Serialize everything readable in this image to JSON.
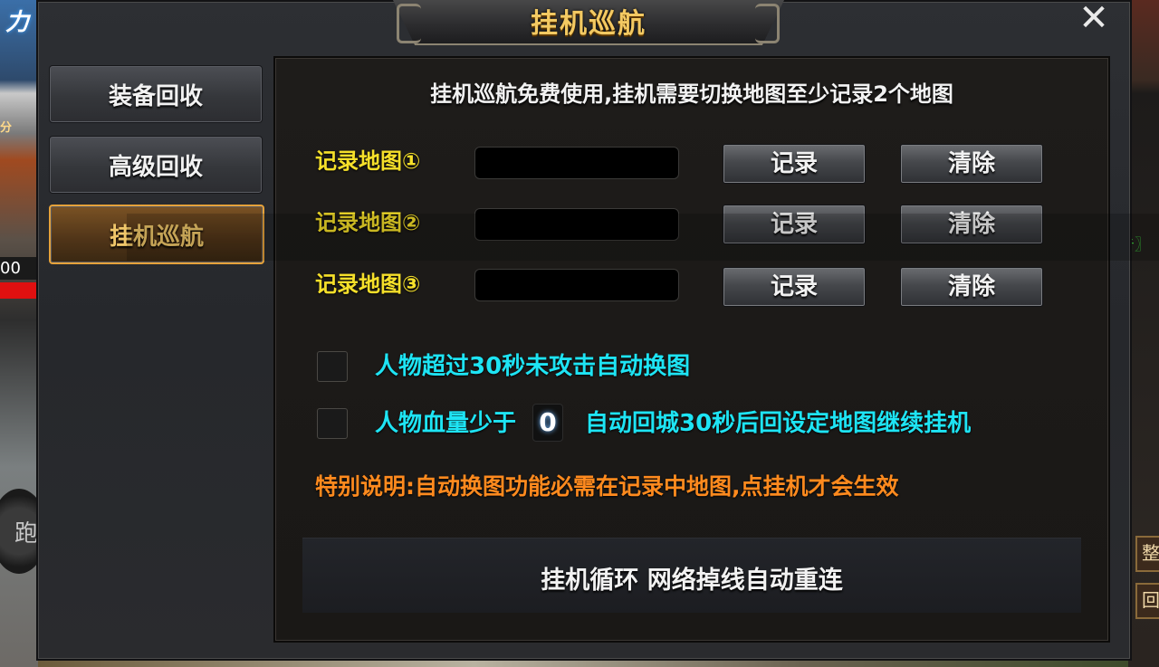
{
  "background": {
    "power_text": "力",
    "score_text": "分",
    "hp_text": "00",
    "run_button": "跑",
    "notice_tag": "〖公告〗",
    "right_buttons": [
      "整",
      "回"
    ]
  },
  "panel": {
    "title": "挂机巡航",
    "close_icon": "close-icon"
  },
  "sidebar": {
    "items": [
      {
        "label": "装备回收",
        "active": false
      },
      {
        "label": "高级回收",
        "active": false
      },
      {
        "label": "挂机巡航",
        "active": true
      }
    ]
  },
  "content": {
    "notice": "挂机巡航免费使用,挂机需要切换地图至少记录2个地图",
    "rows": [
      {
        "label": "记录地图①",
        "value": "",
        "record_label": "记录",
        "clear_label": "清除"
      },
      {
        "label": "记录地图②",
        "value": "",
        "record_label": "记录",
        "clear_label": "清除"
      },
      {
        "label": "记录地图③",
        "value": "",
        "record_label": "记录",
        "clear_label": "清除"
      }
    ],
    "options": {
      "auto_switch": {
        "checked": false,
        "text": "人物超过30秒未攻击自动换图"
      },
      "low_hp": {
        "checked": false,
        "text_before": "人物血量少于",
        "value": "0",
        "text_after": "自动回城30秒后回设定地图继续挂机"
      }
    },
    "remark": "特别说明:自动换图功能必需在记录中地图,点挂机才会生效",
    "footer": "挂机循环 网络掉线自动重连"
  },
  "colors": {
    "title_gold": "#f3c962",
    "label_yellow": "#f6e02a",
    "option_cyan": "#1ee4f4",
    "remark_orange": "#ff8a1e",
    "active_border": "#e6a23a"
  }
}
